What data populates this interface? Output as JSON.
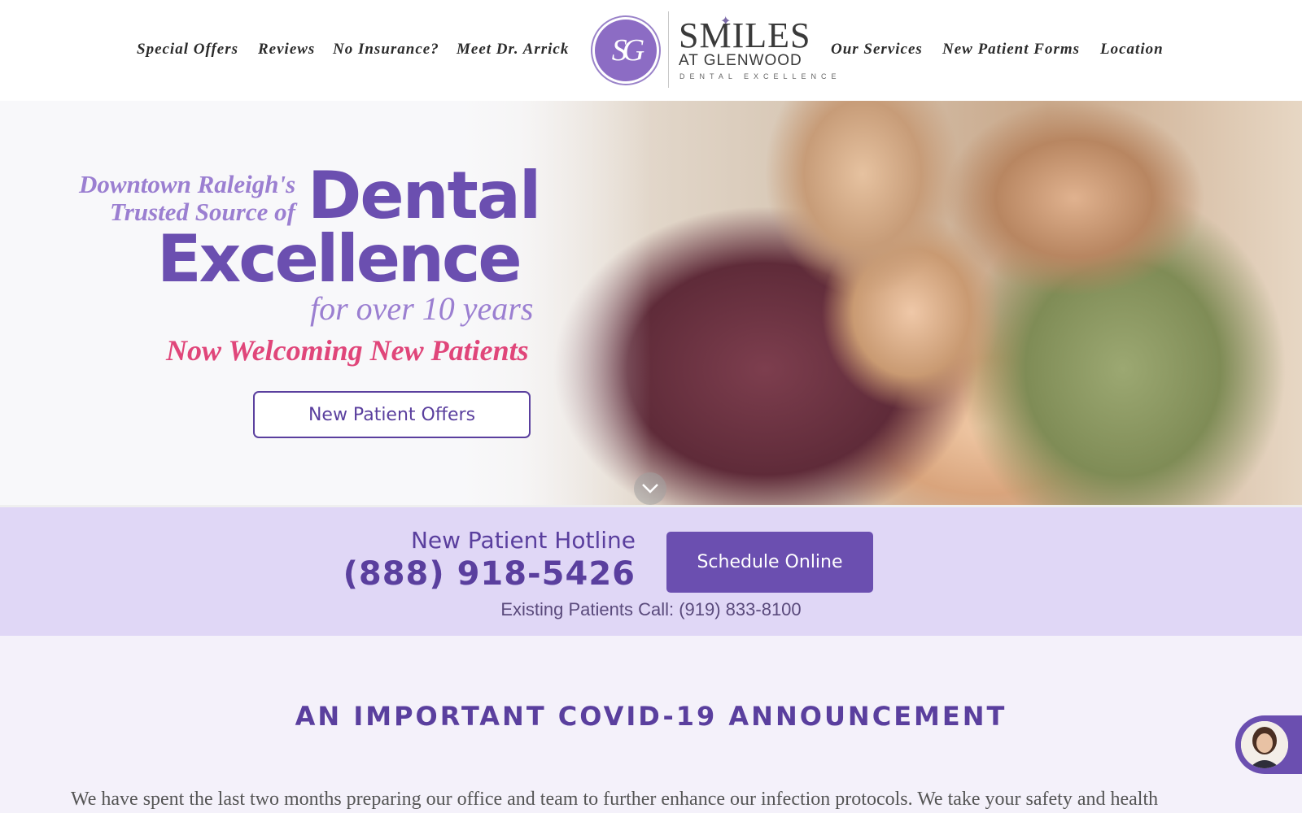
{
  "header": {
    "nav_left": [
      "Special Offers",
      "Reviews",
      "No Insurance?",
      "Meet Dr. Arrick"
    ],
    "nav_right": [
      "Our Services",
      "New Patient Forms",
      "Location"
    ],
    "logo": {
      "monogram": "SG",
      "line1": "SMILES",
      "line2": "AT GLENWOOD",
      "line3": "DENTAL EXCELLENCE"
    }
  },
  "hero": {
    "tagline_line1": "Downtown Raleigh's",
    "tagline_line2": "Trusted Source of",
    "headline_1": "Dental",
    "headline_2": "Excellence",
    "years": "for over 10 years",
    "welcome": "Now Welcoming New Patients",
    "button": "New Patient Offers"
  },
  "hotline": {
    "label": "New Patient Hotline",
    "number": "(888) 918-5426",
    "schedule_button": "Schedule Online",
    "existing_label": "Existing Patients Call: ",
    "existing_number": "(919) 833-8100"
  },
  "announcement": {
    "title": "AN IMPORTANT COVID-19 ANNOUNCEMENT",
    "text": "We have spent the last two months preparing our office and team to further enhance our infection protocols. We take your safety and health"
  },
  "colors": {
    "brand_purple": "#6b4fb0",
    "accent_pink": "#e0467a",
    "band_lavender": "#e0d7f6"
  },
  "icons": {
    "scroll": "chevron-down-icon",
    "chat": "chat-avatar-icon"
  }
}
